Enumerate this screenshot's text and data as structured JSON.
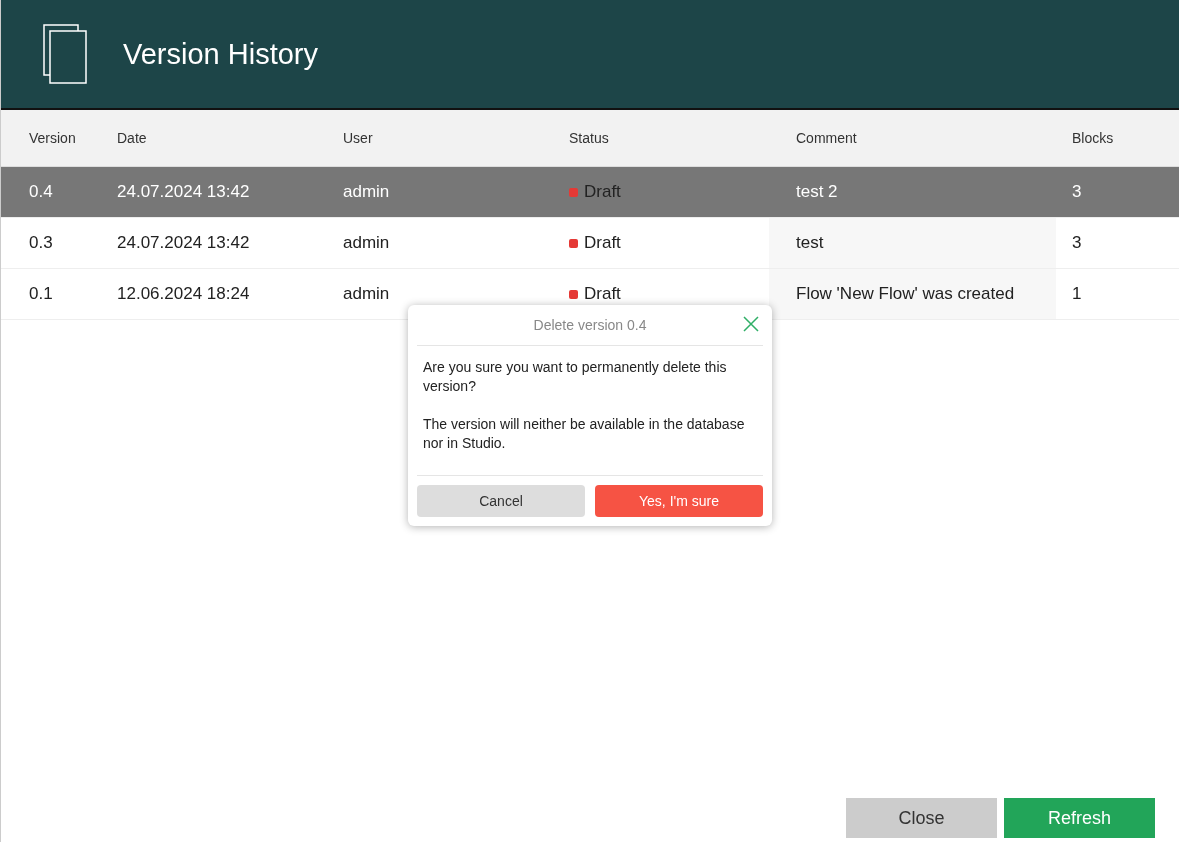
{
  "header": {
    "title": "Version History"
  },
  "table": {
    "columns": [
      "Version",
      "Date",
      "User",
      "Status",
      "Comment",
      "Blocks"
    ],
    "rows": [
      {
        "version": "0.4",
        "date": "24.07.2024 13:42",
        "user": "admin",
        "status": {
          "label": "Draft",
          "color": "#e53935"
        },
        "comment": "test 2",
        "blocks": "3",
        "selected": true
      },
      {
        "version": "0.3",
        "date": "24.07.2024 13:42",
        "user": "admin",
        "status": {
          "label": "Draft",
          "color": "#e53935"
        },
        "comment": "test",
        "blocks": "3",
        "selected": false
      },
      {
        "version": "0.1",
        "date": "12.06.2024 18:24",
        "user": "admin",
        "status": {
          "label": "Draft",
          "color": "#e53935"
        },
        "comment": "Flow 'New Flow' was created",
        "blocks": "1",
        "selected": false
      }
    ]
  },
  "dialog": {
    "title": "Delete version 0.4",
    "paragraphs": [
      "Are you sure you want to permanently delete this version?",
      "The version will neither be available in the database nor in Studio."
    ],
    "buttons": [
      {
        "label": "Cancel",
        "kind": "secondary"
      },
      {
        "label": "Yes, I'm sure",
        "kind": "danger"
      }
    ]
  },
  "footer": {
    "buttons": [
      {
        "label": "Close",
        "kind": "secondary"
      },
      {
        "label": "Refresh",
        "kind": "primary"
      }
    ]
  }
}
